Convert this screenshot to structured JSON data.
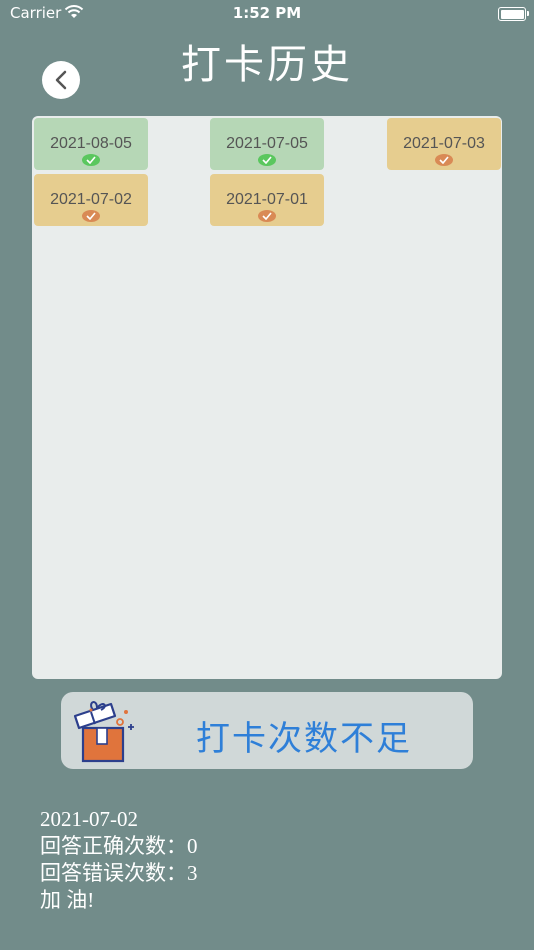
{
  "status_bar": {
    "carrier": "Carrier",
    "time": "1:52 PM"
  },
  "header": {
    "title": "打卡历史"
  },
  "calendar": {
    "days": [
      {
        "date": "2021-08-05",
        "status": "correct"
      },
      {
        "date": "2021-07-05",
        "status": "correct"
      },
      {
        "date": "2021-07-03",
        "status": "partial"
      },
      {
        "date": "2021-07-02",
        "status": "partial"
      },
      {
        "date": "2021-07-01",
        "status": "partial"
      }
    ]
  },
  "reward": {
    "label": "打卡次数不足"
  },
  "summary": {
    "date": "2021-07-02",
    "correct_line": "回答正确次数：0",
    "wrong_line": "回答错误次数：3",
    "encourage": "加 油!"
  },
  "colors": {
    "background": "#728c8a",
    "correct": "#b6d7b6",
    "partial": "#e6cd8f",
    "accent": "#2e7fd8"
  }
}
